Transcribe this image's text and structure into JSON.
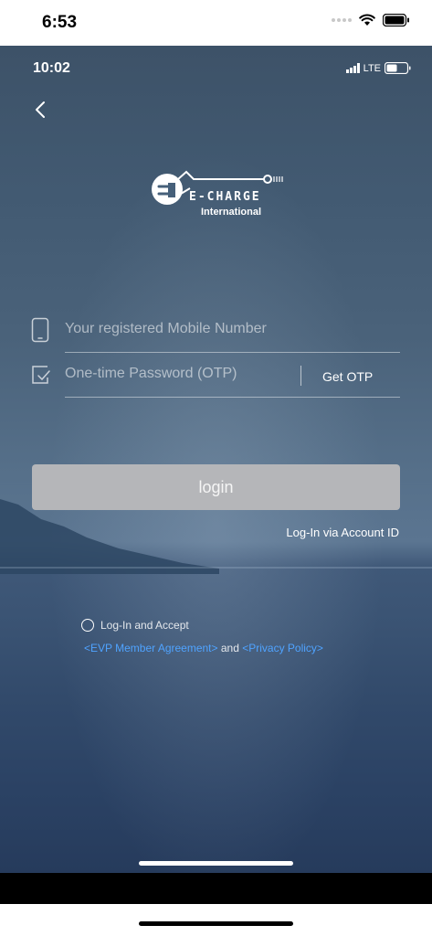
{
  "outer_status": {
    "time": "6:53"
  },
  "app": {
    "status": {
      "time": "10:02",
      "network": "LTE"
    },
    "logo": {
      "brand": "E-CHARGE",
      "subtitle": "International"
    },
    "phone_field": {
      "placeholder": "Your registered Mobile Number",
      "value": ""
    },
    "otp_field": {
      "placeholder": "One-time Password (OTP)",
      "value": "",
      "button_label": "Get OTP"
    },
    "login_button": {
      "label": "login",
      "state": "disabled"
    },
    "alt_login_link": "Log-In via Account ID",
    "consent": {
      "checked": false,
      "label": "Log-In and Accept",
      "agreement_link": "<EVP Member Agreement>",
      "joiner": " and ",
      "privacy_link": "<Privacy Policy>"
    },
    "colors": {
      "link": "#4fa3ff",
      "button_disabled": "#b5b6b9"
    }
  }
}
